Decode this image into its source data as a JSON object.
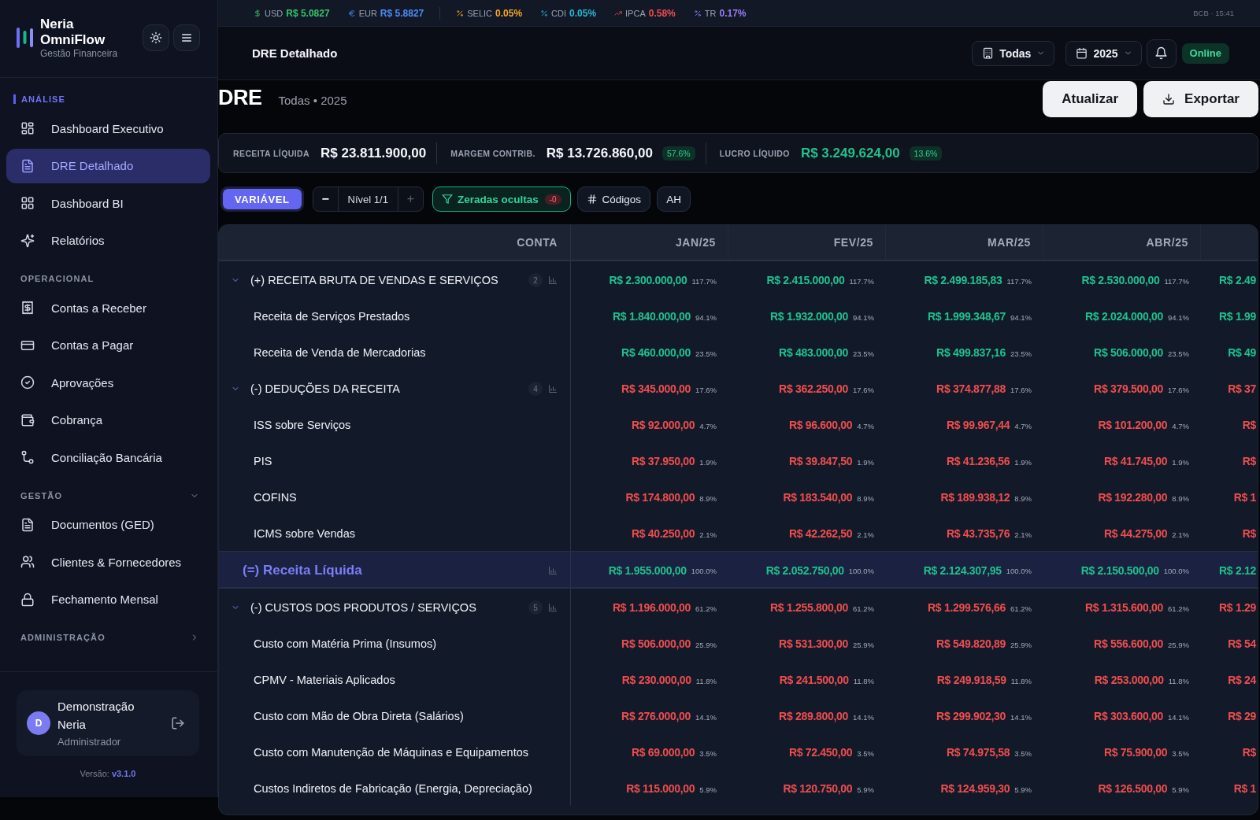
{
  "sidebar": {
    "brand": {
      "name": "Neria OmniFlow",
      "tagline": "Gestão Financeira"
    },
    "sections": [
      {
        "title": "ANÁLISE",
        "kind": "static",
        "active": true,
        "items": [
          {
            "label": "Dashboard Executivo",
            "selected": false
          },
          {
            "label": "DRE Detalhado",
            "selected": true
          },
          {
            "label": "Dashboard BI",
            "selected": false
          },
          {
            "label": "Relatórios",
            "selected": false
          }
        ]
      },
      {
        "title": "OPERACIONAL",
        "kind": "static",
        "active": false,
        "items": [
          {
            "label": "Contas a Receber",
            "selected": false
          },
          {
            "label": "Contas a Pagar",
            "selected": false
          },
          {
            "label": "Aprovações",
            "selected": false
          },
          {
            "label": "Cobrança",
            "selected": false
          },
          {
            "label": "Conciliação Bancária",
            "selected": false
          }
        ]
      },
      {
        "title": "GESTÃO",
        "kind": "collapsible",
        "active": false,
        "expanded": true,
        "items": [
          {
            "label": "Documentos (GED)",
            "selected": false
          },
          {
            "label": "Clientes & Fornecedores",
            "selected": false
          },
          {
            "label": "Fechamento Mensal",
            "selected": false
          }
        ]
      },
      {
        "title": "ADMINISTRAÇÃO",
        "kind": "collapsible",
        "active": false,
        "expanded": false
      }
    ],
    "user": {
      "initial": "D",
      "name": "Demonstração Neria",
      "role": "Administrador"
    },
    "version": "Versão: **v3.1.0**"
  },
  "ticker": {
    "currencies": [
      {
        "label": "USD",
        "value": "R$ 5.0827",
        "color": "#34c46a"
      },
      {
        "label": "EUR",
        "value": "R$ 5.8827",
        "color": "#4c8ef7"
      }
    ],
    "rates": [
      {
        "label": "SELIC",
        "value": "0.05%",
        "color": "#f5a623"
      },
      {
        "label": "CDI",
        "value": "0.05%",
        "color": "#22b8d4"
      },
      {
        "label": "IPCA",
        "value": "0.58%",
        "color": "#f04e4e"
      },
      {
        "label": "TR",
        "value": "0.17%",
        "color": "#9a7cf6"
      }
    ],
    "source": "BCB · 15:41"
  },
  "header": {
    "title": "DRE Detalhado",
    "filters": [
      {
        "label": "Todas"
      },
      {
        "label": "2025"
      }
    ],
    "status": "Online"
  },
  "page": {
    "title": "DRE",
    "subtitle": "Todas • 2025",
    "actions": [
      {
        "label": "Atualizar"
      },
      {
        "label": "Exportar"
      }
    ]
  },
  "summary": [
    {
      "label": "RECEITA LÍQUIDA",
      "value": "R$ 23.811.900,00",
      "positive": false
    },
    {
      "label": "MARGEM CONTRIB.",
      "value": "R$ 13.726.860,00",
      "positive": false,
      "badge": "57.6%"
    },
    {
      "label": "LUCRO LÍQUIDO",
      "value": "R$ 3.249.624,00",
      "positive": true,
      "badge": "13.6%"
    }
  ],
  "toolbar": {
    "mode": {
      "label": "VARIÁVEL",
      "on": true
    },
    "level": {
      "decrease": {
        "label": "−",
        "disabled": false
      },
      "value": "Nível 1/1",
      "increase": {
        "label": "+",
        "disabled": true
      }
    },
    "toggles": [
      {
        "label": "Zeradas ocultas",
        "on": true,
        "count": "-0"
      },
      {
        "label": "Códigos",
        "on": false
      },
      {
        "label": "AH",
        "on": false
      }
    ]
  },
  "table": {
    "columns": [
      "CONTA",
      "JAN/25",
      "FEV/25",
      "MAR/25",
      "ABR/25"
    ],
    "rows": [
      {
        "kind": "group",
        "label": "(+) RECEITA BRUTA DE VENDAS E SERVIÇOS",
        "expanded": true,
        "count": "2",
        "negative": false,
        "values": [
          {
            "amount": "R$ 2.300.000,00",
            "pct": "117.7%"
          },
          {
            "amount": "R$ 2.415.000,00",
            "pct": "117.7%"
          },
          {
            "amount": "R$ 2.499.185,83",
            "pct": "117.7%"
          },
          {
            "amount": "R$ 2.530.000,00",
            "pct": "117.7%"
          }
        ],
        "column_5": "R$ 2.49",
        "children": [
          {
            "kind": "item",
            "label": "Receita de Serviços Prestados",
            "negative": false,
            "values": [
              {
                "amount": "R$ 1.840.000,00",
                "pct": "94.1%"
              },
              {
                "amount": "R$ 1.932.000,00",
                "pct": "94.1%"
              },
              {
                "amount": "R$ 1.999.348,67",
                "pct": "94.1%"
              },
              {
                "amount": "R$ 2.024.000,00",
                "pct": "94.1%"
              }
            ],
            "column_5": "R$ 1.99"
          },
          {
            "kind": "item",
            "label": "Receita de Venda de Mercadorias",
            "negative": false,
            "values": [
              {
                "amount": "R$ 460.000,00",
                "pct": "23.5%"
              },
              {
                "amount": "R$ 483.000,00",
                "pct": "23.5%"
              },
              {
                "amount": "R$ 499.837,16",
                "pct": "23.5%"
              },
              {
                "amount": "R$ 506.000,00",
                "pct": "23.5%"
              }
            ],
            "column_5": "R$ 49"
          }
        ]
      },
      {
        "kind": "group",
        "label": "(-) DEDUÇÕES DA RECEITA",
        "expanded": true,
        "count": "4",
        "negative": true,
        "values": [
          {
            "amount": "R$ 345.000,00",
            "pct": "17.6%"
          },
          {
            "amount": "R$ 362.250,00",
            "pct": "17.6%"
          },
          {
            "amount": "R$ 374.877,88",
            "pct": "17.6%"
          },
          {
            "amount": "R$ 379.500,00",
            "pct": "17.6%"
          }
        ],
        "column_5": "R$ 37",
        "children": [
          {
            "kind": "item",
            "label": "ISS sobre Serviços",
            "negative": true,
            "values": [
              {
                "amount": "R$ 92.000,00",
                "pct": "4.7%"
              },
              {
                "amount": "R$ 96.600,00",
                "pct": "4.7%"
              },
              {
                "amount": "R$ 99.967,44",
                "pct": "4.7%"
              },
              {
                "amount": "R$ 101.200,00",
                "pct": "4.7%"
              }
            ],
            "column_5": "R$"
          },
          {
            "kind": "item",
            "label": "PIS",
            "negative": true,
            "values": [
              {
                "amount": "R$ 37.950,00",
                "pct": "1.9%"
              },
              {
                "amount": "R$ 39.847,50",
                "pct": "1.9%"
              },
              {
                "amount": "R$ 41.236,56",
                "pct": "1.9%"
              },
              {
                "amount": "R$ 41.745,00",
                "pct": "1.9%"
              }
            ],
            "column_5": "R$"
          },
          {
            "kind": "item",
            "label": "COFINS",
            "negative": true,
            "values": [
              {
                "amount": "R$ 174.800,00",
                "pct": "8.9%"
              },
              {
                "amount": "R$ 183.540,00",
                "pct": "8.9%"
              },
              {
                "amount": "R$ 189.938,12",
                "pct": "8.9%"
              },
              {
                "amount": "R$ 192.280,00",
                "pct": "8.9%"
              }
            ],
            "column_5": "R$ 1"
          },
          {
            "kind": "item",
            "label": "ICMS sobre Vendas",
            "negative": true,
            "values": [
              {
                "amount": "R$ 40.250,00",
                "pct": "2.1%"
              },
              {
                "amount": "R$ 42.262,50",
                "pct": "2.1%"
              },
              {
                "amount": "R$ 43.735,76",
                "pct": "2.1%"
              },
              {
                "amount": "R$ 44.275,00",
                "pct": "2.1%"
              }
            ],
            "column_5": "R$"
          }
        ]
      },
      {
        "kind": "total",
        "label": "(=) Receita Líquida",
        "negative": false,
        "values": [
          {
            "amount": "R$ 1.955.000,00",
            "pct": "100.0%"
          },
          {
            "amount": "R$ 2.052.750,00",
            "pct": "100.0%"
          },
          {
            "amount": "R$ 2.124.307,95",
            "pct": "100.0%"
          },
          {
            "amount": "R$ 2.150.500,00",
            "pct": "100.0%"
          }
        ],
        "column_5": "R$ 2.12"
      },
      {
        "kind": "group",
        "label": "(-) CUSTOS DOS PRODUTOS / SERVIÇOS",
        "expanded": true,
        "count": "5",
        "negative": true,
        "values": [
          {
            "amount": "R$ 1.196.000,00",
            "pct": "61.2%"
          },
          {
            "amount": "R$ 1.255.800,00",
            "pct": "61.2%"
          },
          {
            "amount": "R$ 1.299.576,66",
            "pct": "61.2%"
          },
          {
            "amount": "R$ 1.315.600,00",
            "pct": "61.2%"
          }
        ],
        "column_5": "R$ 1.29",
        "children": [
          {
            "kind": "item",
            "label": "Custo com Matéria Prima (Insumos)",
            "negative": true,
            "values": [
              {
                "amount": "R$ 506.000,00",
                "pct": "25.9%"
              },
              {
                "amount": "R$ 531.300,00",
                "pct": "25.9%"
              },
              {
                "amount": "R$ 549.820,89",
                "pct": "25.9%"
              },
              {
                "amount": "R$ 556.600,00",
                "pct": "25.9%"
              }
            ],
            "column_5": "R$ 54"
          },
          {
            "kind": "item",
            "label": "CPMV - Materiais Aplicados",
            "negative": true,
            "values": [
              {
                "amount": "R$ 230.000,00",
                "pct": "11.8%"
              },
              {
                "amount": "R$ 241.500,00",
                "pct": "11.8%"
              },
              {
                "amount": "R$ 249.918,59",
                "pct": "11.8%"
              },
              {
                "amount": "R$ 253.000,00",
                "pct": "11.8%"
              }
            ],
            "column_5": "R$ 24"
          },
          {
            "kind": "item",
            "label": "Custo com Mão de Obra Direta (Salários)",
            "negative": true,
            "values": [
              {
                "amount": "R$ 276.000,00",
                "pct": "14.1%"
              },
              {
                "amount": "R$ 289.800,00",
                "pct": "14.1%"
              },
              {
                "amount": "R$ 299.902,30",
                "pct": "14.1%"
              },
              {
                "amount": "R$ 303.600,00",
                "pct": "14.1%"
              }
            ],
            "column_5": "R$ 29"
          },
          {
            "kind": "item",
            "label": "Custo com Manutenção de Máquinas e Equipamentos",
            "negative": true,
            "values": [
              {
                "amount": "R$ 69.000,00",
                "pct": "3.5%"
              },
              {
                "amount": "R$ 72.450,00",
                "pct": "3.5%"
              },
              {
                "amount": "R$ 74.975,58",
                "pct": "3.5%"
              },
              {
                "amount": "R$ 75.900,00",
                "pct": "3.5%"
              }
            ],
            "column_5": "R$"
          },
          {
            "kind": "item",
            "label": "Custos Indiretos de Fabricação (Energia, Depreciação)",
            "negative": true,
            "values": [
              {
                "amount": "R$ 115.000,00",
                "pct": "5.9%"
              },
              {
                "amount": "R$ 120.750,00",
                "pct": "5.9%"
              },
              {
                "amount": "R$ 124.959,30",
                "pct": "5.9%"
              },
              {
                "amount": "R$ 126.500,00",
                "pct": "5.9%"
              }
            ],
            "column_5": "R$ 1"
          }
        ]
      }
    ]
  }
}
